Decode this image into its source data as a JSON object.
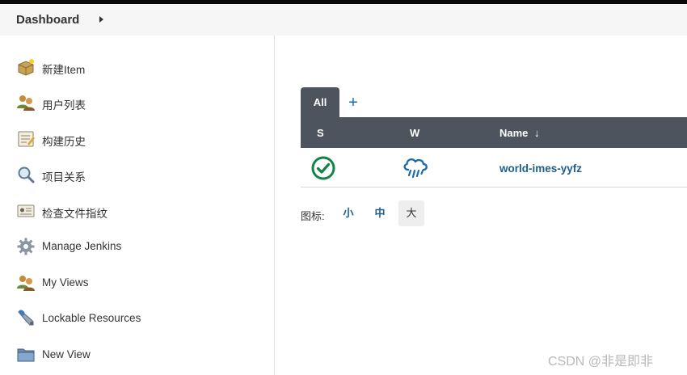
{
  "breadcrumb": {
    "label": "Dashboard"
  },
  "sidebar": {
    "items": [
      {
        "label": "新建Item",
        "icon": "new-item-icon"
      },
      {
        "label": "用户列表",
        "icon": "users-icon"
      },
      {
        "label": "构建历史",
        "icon": "build-history-icon"
      },
      {
        "label": "项目关系",
        "icon": "search-icon"
      },
      {
        "label": "检查文件指纹",
        "icon": "fingerprint-icon"
      },
      {
        "label": "Manage Jenkins",
        "icon": "gear-icon"
      },
      {
        "label": "My Views",
        "icon": "users-icon"
      },
      {
        "label": "Lockable Resources",
        "icon": "lock-icon"
      },
      {
        "label": "New View",
        "icon": "folder-icon"
      }
    ]
  },
  "views": {
    "tabs": [
      {
        "label": "All"
      }
    ],
    "add_label": "+"
  },
  "table": {
    "headers": {
      "status": "S",
      "weather": "W",
      "name": "Name",
      "sort": "↓"
    },
    "rows": [
      {
        "name": "world-imes-yyfz",
        "status": "success",
        "weather": "rain"
      }
    ]
  },
  "icon_size": {
    "label": "图标:",
    "options": [
      {
        "label": "小"
      },
      {
        "label": "中"
      },
      {
        "label": "大",
        "selected": true
      }
    ]
  },
  "watermark": "CSDN @非是即非",
  "colors": {
    "header_bg": "#4d545d",
    "link": "#1d5e8e",
    "success": "#138347",
    "weather": "#1d6ba8"
  }
}
